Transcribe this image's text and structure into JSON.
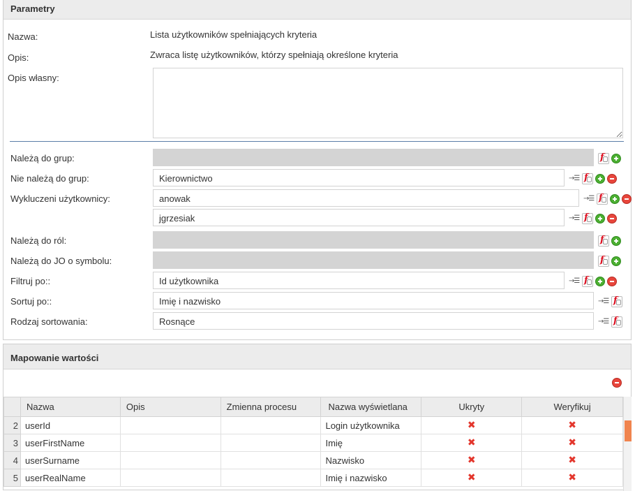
{
  "params": {
    "title": "Parametry",
    "nazwa_label": "Nazwa:",
    "nazwa_value": "Lista użytkowników spełniających kryteria",
    "opis_label": "Opis:",
    "opis_value": "Zwraca listę użytkowników, którzy spełniają określone kryteria",
    "opis_wlasny_label": "Opis własny:",
    "naleza_grup_label": "Należą do grup:",
    "nie_naleza_grup_label": "Nie należą do grup:",
    "nie_naleza_grup_value": "Kierownictwo",
    "wykluczeni_label": "Wykluczeni użytkownicy:",
    "wykluczeni_1": "anowak",
    "wykluczeni_2": "jgrzesiak",
    "naleza_rol_label": "Należą do ról:",
    "naleza_jo_label": "Należą do JO o symbolu:",
    "filtruj_label": "Filtruj po::",
    "filtruj_value": "Id użytkownika",
    "sortuj_label": "Sortuj po::",
    "sortuj_value": "Imię i nazwisko",
    "rodzaj_label": "Rodzaj sortowania:",
    "rodzaj_value": "Rosnące"
  },
  "mapping": {
    "title": "Mapowanie wartości",
    "columns": [
      "Nazwa",
      "Opis",
      "Zmienna procesu",
      "Nazwa wyświetlana",
      "Ukryty",
      "Weryfikuj"
    ],
    "rows": [
      {
        "num": "2",
        "nazwa": "userId",
        "opis": "",
        "zmienna": "",
        "wyswietlana": "Login użytkownika",
        "ukryty": "✖",
        "weryfikuj": "✖"
      },
      {
        "num": "3",
        "nazwa": "userFirstName",
        "opis": "",
        "zmienna": "",
        "wyswietlana": "Imię",
        "ukryty": "✖",
        "weryfikuj": "✖"
      },
      {
        "num": "4",
        "nazwa": "userSurname",
        "opis": "",
        "zmienna": "",
        "wyswietlana": "Nazwisko",
        "ukryty": "✖",
        "weryfikuj": "✖"
      },
      {
        "num": "5",
        "nazwa": "userRealName",
        "opis": "",
        "zmienna": "",
        "wyswietlana": "Imię i nazwisko",
        "ukryty": "✖",
        "weryfikuj": "✖"
      }
    ]
  }
}
